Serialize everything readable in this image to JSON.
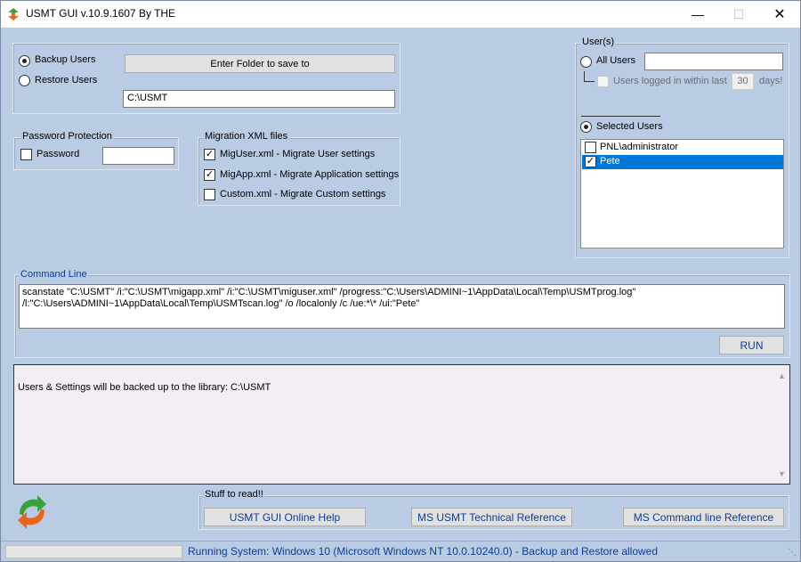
{
  "window": {
    "title": "USMT GUI v.10.9.1607 By THE",
    "icons": {
      "app": "usmt-arrows-icon",
      "minimize": "minimize-icon",
      "maximize": "maximize-icon",
      "close": "close-icon"
    }
  },
  "mode": {
    "backup_label": "Backup Users",
    "restore_label": "Restore Users",
    "selected": "backup",
    "folder_button": "Enter Folder to save to",
    "folder_value": "C:\\USMT"
  },
  "password": {
    "group_label": "Password Protection",
    "checkbox_label": "Password",
    "checked": false,
    "value": ""
  },
  "migration": {
    "group_label": "Migration XML files",
    "items": [
      {
        "label": "MigUser.xml - Migrate User settings",
        "checked": true
      },
      {
        "label": "MigApp.xml - Migrate Application settings",
        "checked": true
      },
      {
        "label": "Custom.xml - Migrate Custom settings",
        "checked": false
      }
    ]
  },
  "users": {
    "group_label": "User(s)",
    "all_users_label": "All Users",
    "all_users_value": "",
    "logged_in_label": "Users logged in within last",
    "days_value": "30",
    "days_label": "days!",
    "selected_users_label": "Selected Users",
    "mode": "selected",
    "list": [
      {
        "name": "PNL\\administrator",
        "checked": false,
        "selected": false
      },
      {
        "name": "Pete",
        "checked": true,
        "selected": true
      }
    ]
  },
  "command": {
    "group_label": "Command Line",
    "text": "scanstate \"C:\\USMT\" /i:\"C:\\USMT\\migapp.xml\" /i:\"C:\\USMT\\miguser.xml\" /progress:\"C:\\Users\\ADMINI~1\\AppData\\Local\\Temp\\USMTprog.log\" /l:\"C:\\Users\\ADMINI~1\\AppData\\Local\\Temp\\USMTscan.log\" /o /localonly /c /ue:*\\* /ui:\"Pete\"",
    "run_button": "RUN"
  },
  "log": {
    "text": "Users & Settings will be backed up to the library: C:\\USMT"
  },
  "links": {
    "group_label": "Stuff to read!!",
    "buttons": [
      "USMT GUI Online Help",
      "MS USMT Technical Reference",
      "MS Command line Reference"
    ]
  },
  "status": {
    "progress_percent": 0,
    "text": "Running System: Windows 10  (Microsoft Windows NT 10.0.10240.0) - Backup and Restore allowed"
  },
  "colors": {
    "window_bg": "#b9cce3",
    "accent_text": "#0b3d99",
    "selection": "#0078d7"
  }
}
